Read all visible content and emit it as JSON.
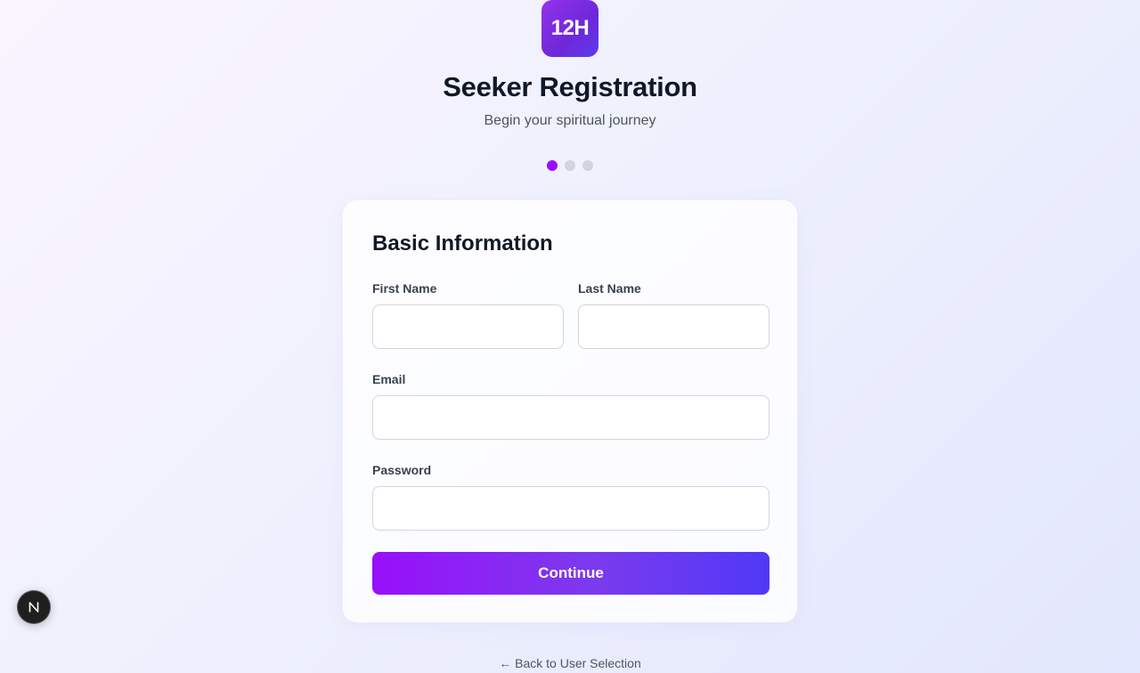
{
  "logo": {
    "text": "12H"
  },
  "header": {
    "title": "Seeker Registration",
    "subtitle": "Begin your spiritual journey"
  },
  "steps": {
    "total": 3,
    "current": 1
  },
  "form": {
    "heading": "Basic Information",
    "first_name": {
      "label": "First Name",
      "value": ""
    },
    "last_name": {
      "label": "Last Name",
      "value": ""
    },
    "email": {
      "label": "Email",
      "value": ""
    },
    "password": {
      "label": "Password",
      "value": ""
    },
    "submit_label": "Continue"
  },
  "footer": {
    "back_link": "← Back to User Selection"
  },
  "badge": {
    "icon": "nextjs-logo-icon"
  },
  "colors": {
    "accent": "#9810fa",
    "accent_end": "#4f39f6",
    "step_inactive": "#d1d5db"
  }
}
